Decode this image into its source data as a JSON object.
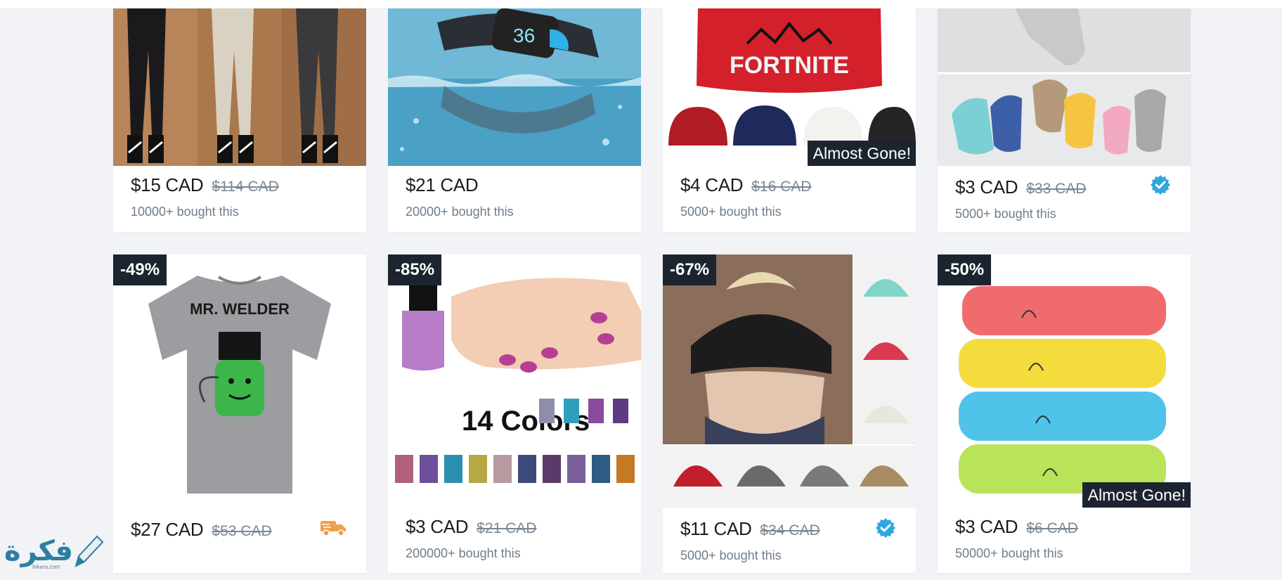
{
  "products": [
    {
      "price": "$15 CAD",
      "original": "$114 CAD",
      "sold": "10000+ bought this",
      "discount": "",
      "tag": "",
      "badge": ""
    },
    {
      "price": "$21 CAD",
      "original": "",
      "sold": "20000+ bought this",
      "discount": "",
      "tag": "",
      "badge": ""
    },
    {
      "price": "$4 CAD",
      "original": "$16 CAD",
      "sold": "5000+ bought this",
      "discount": "",
      "tag": "Almost Gone!",
      "badge": ""
    },
    {
      "price": "$3 CAD",
      "original": "$33 CAD",
      "sold": "5000+ bought this",
      "discount": "",
      "tag": "",
      "badge": "verified-check-icon"
    },
    {
      "price": "$27 CAD",
      "original": "$53 CAD",
      "sold": "",
      "discount": "-49%",
      "tag": "",
      "badge": "delivery-truck-icon"
    },
    {
      "price": "$3 CAD",
      "original": "$21 CAD",
      "sold": "200000+ bought this",
      "discount": "-85%",
      "tag": "",
      "badge": ""
    },
    {
      "price": "$11 CAD",
      "original": "$34 CAD",
      "sold": "5000+ bought this",
      "discount": "-67%",
      "tag": "",
      "badge": "verified-check-icon"
    },
    {
      "price": "$3 CAD",
      "original": "$6 CAD",
      "sold": "50000+ bought this",
      "discount": "-50%",
      "tag": "Almost Gone!",
      "badge": ""
    }
  ],
  "image_text": {
    "beanie": "FORTNITE",
    "tshirt": "MR. WELDER",
    "nail_polish": "14 Colors",
    "watch": "36"
  },
  "watermark": {
    "main": "فكرة",
    "sub": "fekera.com"
  },
  "colors": {
    "accent_blue": "#2fa8e0",
    "truck_orange": "#f0a04b",
    "tag_dark": "#1c2430"
  }
}
